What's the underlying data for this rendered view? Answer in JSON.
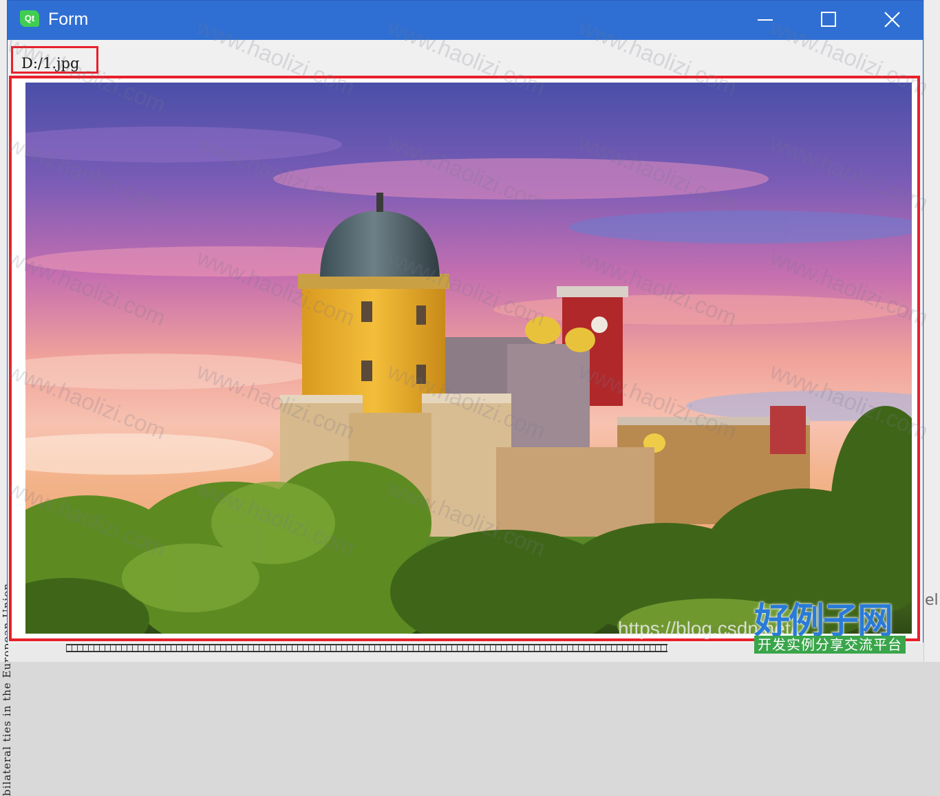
{
  "window": {
    "app_icon_text": "Qt",
    "title": "Form"
  },
  "controls": {
    "minimize": "minimize",
    "maximize": "maximize",
    "close": "close"
  },
  "path_label": "D:/1.jpg",
  "image": {
    "kind": "photo",
    "subject": "castle"
  },
  "background": {
    "left_vertical_text": "bilateral ties in the European Union"
  },
  "watermark": {
    "text": "www.haolizi.com",
    "corner_url": "https://blog.csdn.net/",
    "corner_logo": "好例子网",
    "corner_tagline": "开发实例分享交流平台"
  },
  "colors": {
    "titlebar": "#2f6fd3",
    "highlight_border": "#e8202a",
    "qt_green": "#41cd52"
  }
}
